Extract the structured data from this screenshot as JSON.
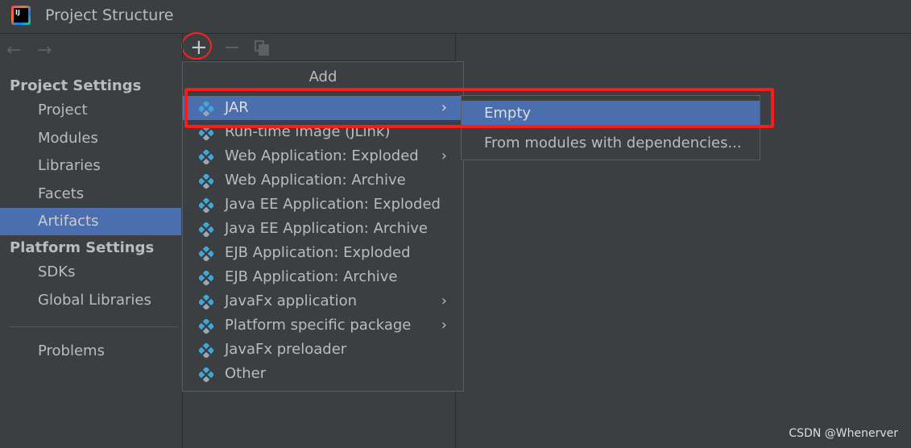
{
  "window": {
    "title": "Project Structure",
    "logo_text": "IJ"
  },
  "toolbar": {
    "back_icon": "arrow-left-icon",
    "forward_icon": "arrow-right-icon",
    "add": "+",
    "remove": "−",
    "copy_icon": "copy-icon"
  },
  "sidebar": {
    "project_settings": "Project Settings",
    "items": [
      "Project",
      "Modules",
      "Libraries",
      "Facets",
      "Artifacts"
    ],
    "platform_settings": "Platform Settings",
    "platform_items": [
      "SDKs",
      "Global Libraries"
    ],
    "problems": "Problems",
    "selected": "Artifacts"
  },
  "menu": {
    "header": "Add",
    "items": [
      {
        "label": "JAR",
        "submenu": true
      },
      {
        "label": "Run-time image (JLink)",
        "submenu": false
      },
      {
        "label": "Web Application: Exploded",
        "submenu": true
      },
      {
        "label": "Web Application: Archive",
        "submenu": false
      },
      {
        "label": "Java EE Application: Exploded",
        "submenu": false
      },
      {
        "label": "Java EE Application: Archive",
        "submenu": false
      },
      {
        "label": "EJB Application: Exploded",
        "submenu": false
      },
      {
        "label": "EJB Application: Archive",
        "submenu": false
      },
      {
        "label": "JavaFx application",
        "submenu": true
      },
      {
        "label": "Platform specific package",
        "submenu": true
      },
      {
        "label": "JavaFx preloader",
        "submenu": false
      },
      {
        "label": "Other",
        "submenu": false
      }
    ],
    "arrow": "›"
  },
  "submenu": {
    "items": [
      "Empty",
      "From modules with dependencies..."
    ]
  },
  "watermark": "CSDN @Whenerver",
  "colors": {
    "selection": "#4b6eaf",
    "highlight": "#ff1a1a",
    "background": "#3c3f41"
  }
}
